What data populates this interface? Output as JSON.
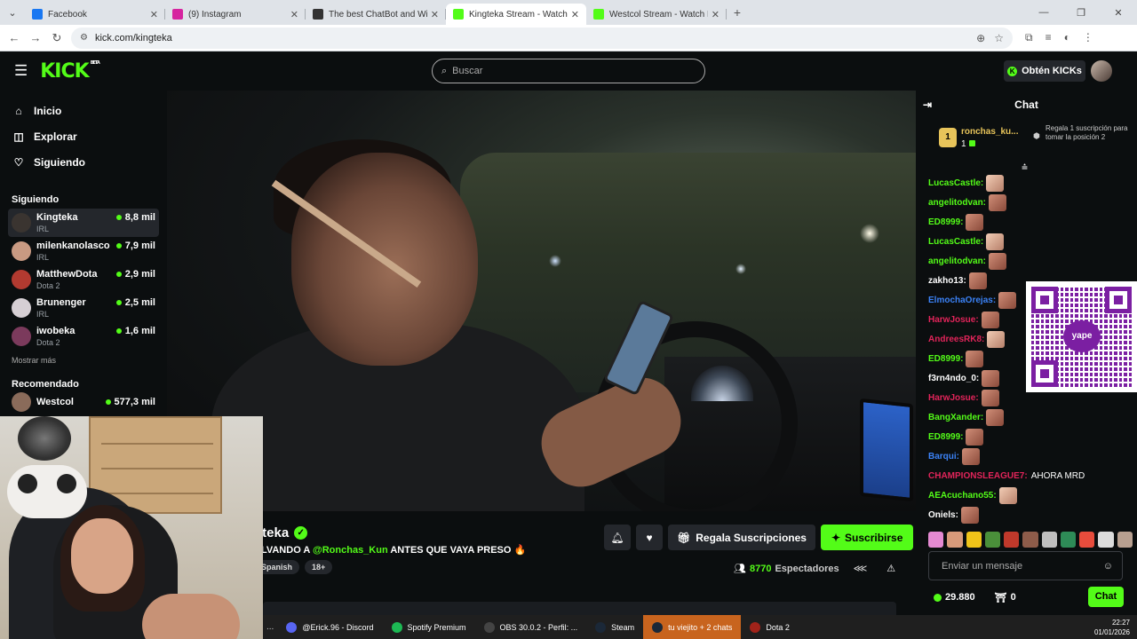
{
  "browser": {
    "tabs": [
      {
        "title": "Facebook",
        "color": "#1877f2",
        "active": false
      },
      {
        "title": "(9) Instagram",
        "color": "#d6249f",
        "active": false
      },
      {
        "title": "The best ChatBot and Widgets",
        "color": "#333333",
        "active": false
      },
      {
        "title": "Kingteka Stream - Watch Li...",
        "color": "#53fc18",
        "active": true
      },
      {
        "title": "Westcol Stream - Watch Live o...",
        "color": "#53fc18",
        "active": false
      }
    ],
    "url": "kick.com/kingteka"
  },
  "header": {
    "logo": "KICK",
    "beta": "BETA",
    "search_placeholder": "Buscar",
    "kicks_label": "Obtén KICKs"
  },
  "sidebar": {
    "nav": [
      {
        "label": "Inicio",
        "icon": "home-icon",
        "glyph": "⌂"
      },
      {
        "label": "Explorar",
        "icon": "compass-icon",
        "glyph": "◫"
      },
      {
        "label": "Siguiendo",
        "icon": "heart-icon",
        "glyph": "♡"
      }
    ],
    "following_title": "Siguiendo",
    "following": [
      {
        "name": "Kingteka",
        "category": "IRL",
        "viewers": "8,8 mil",
        "color": "#3a3430",
        "active": true
      },
      {
        "name": "milenkanolasco",
        "category": "IRL",
        "viewers": "7,9 mil",
        "color": "#c99a82",
        "active": false
      },
      {
        "name": "MatthewDota",
        "category": "Dota 2",
        "viewers": "2,9 mil",
        "color": "#b23a30",
        "active": false
      },
      {
        "name": "Brunenger",
        "category": "IRL",
        "viewers": "2,5 mil",
        "color": "#d6cfd4",
        "active": false
      },
      {
        "name": "iwobeka",
        "category": "Dota 2",
        "viewers": "1,6 mil",
        "color": "#7b3a5c",
        "active": false
      }
    ],
    "show_more": "Mostrar más",
    "recommended_title": "Recomendado",
    "recommended_first": {
      "name": "Westcol",
      "viewers": "577,3 mil"
    }
  },
  "stream": {
    "streamer": "Kingteka",
    "streamer_visible": "gteka",
    "title_prefix": "ALVANDO A ",
    "title_mention": "@Ronchas_Kun",
    "title_suffix": " ANTES QUE VAYA PRESO 🔥",
    "tags": [
      "Spanish",
      "18+"
    ],
    "gift_label": "Regala Suscripciones",
    "subscribe_label": "Suscribirse",
    "viewer_count": "8770",
    "viewer_label": "Espectadores"
  },
  "chat": {
    "title": "Chat",
    "pinned": {
      "rank": "1",
      "name": "ronchas_ku...",
      "count": "1",
      "hint": "Regala 1 suscripción para tomar la posición 2"
    },
    "messages": [
      {
        "user": "LucasCastle:",
        "color": "#53fc18",
        "text": "",
        "emote": "w"
      },
      {
        "user": "angelitodvan:",
        "color": "#53fc18",
        "text": "",
        "emote": "d"
      },
      {
        "user": "ED8999:",
        "color": "#53fc18",
        "text": "",
        "emote": "d"
      },
      {
        "user": "LucasCastle:",
        "color": "#53fc18",
        "text": "",
        "emote": "w"
      },
      {
        "user": "angelitodvan:",
        "color": "#53fc18",
        "text": "",
        "emote": "d"
      },
      {
        "user": "zakho13:",
        "color": "#ffffff",
        "text": "",
        "emote": "d"
      },
      {
        "user": "ElmochaOrejas:",
        "color": "#3b82f6",
        "text": "",
        "emote": "d"
      },
      {
        "user": "HarwJosue:",
        "color": "#e2245a",
        "text": "",
        "emote": "d"
      },
      {
        "user": "AndreesRK8:",
        "color": "#e2245a",
        "text": "",
        "emote": "w"
      },
      {
        "user": "ED8999:",
        "color": "#53fc18",
        "text": "",
        "emote": "d"
      },
      {
        "user": "f3rn4ndo_0:",
        "color": "#ffffff",
        "text": "",
        "emote": "d"
      },
      {
        "user": "HarwJosue:",
        "color": "#e2245a",
        "text": "",
        "emote": "d"
      },
      {
        "user": "BangXander:",
        "color": "#53fc18",
        "text": "",
        "emote": "d"
      },
      {
        "user": "ED8999:",
        "color": "#53fc18",
        "text": "",
        "emote": "d"
      },
      {
        "user": "Barqui:",
        "color": "#3b82f6",
        "text": "",
        "emote": "d"
      },
      {
        "user": "CHAMPIONSLEAGUE7:",
        "color": "#e2245a",
        "text": "AHORA MRD",
        "emote": ""
      },
      {
        "user": "AEAcuchano55:",
        "color": "#53fc18",
        "text": "",
        "emote": "w"
      },
      {
        "user": "Oniels:",
        "color": "#ffffff",
        "text": "",
        "emote": "d"
      }
    ],
    "qr_label": "yape",
    "emote_colors": [
      "#e58ad2",
      "#d89a7a",
      "#f0c419",
      "#4a8f3a",
      "#c0392b",
      "#8e5c4a",
      "#bfbfbf",
      "#2e8b57",
      "#e74c3c",
      "#dcdcdc",
      "#b8a090"
    ],
    "input_placeholder": "Enviar un mensaje",
    "points": "29.880",
    "gift_count": "0",
    "send_label": "Chat"
  },
  "taskbar": {
    "items": [
      {
        "label": "@Erick.96 - Discord",
        "color": "#5865f2",
        "active": false
      },
      {
        "label": "Spotify Premium",
        "color": "#1db954",
        "active": false
      },
      {
        "label": "OBS 30.0.2 - Perfil: ...",
        "color": "#444444",
        "active": false
      },
      {
        "label": "Steam",
        "color": "#1b2838",
        "active": false
      },
      {
        "label": "tu viejito + 2 chats",
        "color": "#1b2838",
        "active": true
      },
      {
        "label": "Dota 2",
        "color": "#a1231a",
        "active": false
      }
    ],
    "time": "22:27",
    "date": "01/01/2026"
  }
}
